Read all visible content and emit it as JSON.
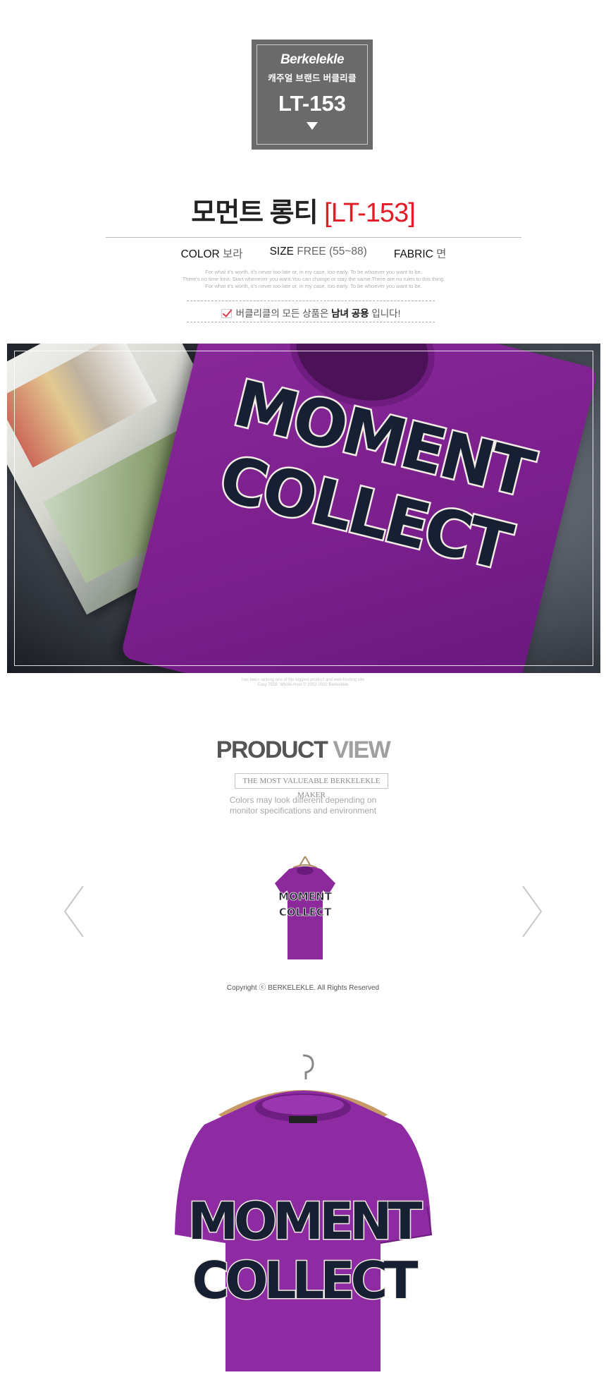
{
  "badge": {
    "brand": "Berkelekle",
    "subtitle": "캐주얼 브랜드 버클리클",
    "code": "LT-153"
  },
  "title": {
    "name": "모먼트 롱티",
    "code": "[LT-153]"
  },
  "specs": [
    {
      "label": "COLOR",
      "value": "보라"
    },
    {
      "label": "SIZE",
      "value": "FREE (55~88)"
    },
    {
      "label": "FABRIC",
      "value": "면"
    }
  ],
  "fine_print": [
    "For what it's worth, it's never too late or, in my case, too early. To be whoever you want to be.",
    "There's no time limit. Start whenever you want.You can change or stay the same.There are no rules to this thing.",
    "For what it's worth, it's never too late or, in my case, too early. To be whoever you want to be."
  ],
  "unisex": {
    "prefix": "버클리클의 모든 상품은",
    "highlight": "남녀 공용",
    "suffix": "입니다!"
  },
  "hero": {
    "shirt_text_line1": "MOMENT",
    "shirt_text_line2": "COLLECT",
    "caption_line1": "has been ranking one of the biggest product and web-hosting site",
    "caption_line2": "Easy 7558. Whole-Host © 2002-2012 Berkelekle"
  },
  "product_view": {
    "title_bold": "PRODUCT",
    "title_light": "VIEW",
    "tagline": "THE MOST VALUEABLE BERKELEKLE MAKER",
    "note_line1": "Colors may look different depending on",
    "note_line2": "monitor specifications and environment",
    "copyright": "Copyright ⓒ BERKELEKLE. All Rights Reserved"
  },
  "icons": {
    "prev": "chevron-left-icon",
    "next": "chevron-right-icon",
    "check": "check-icon"
  },
  "colors": {
    "accent_red": "#e11c26",
    "badge_gray": "#6a6a6a",
    "shirt_purple": "#8c2a9c",
    "shirt_print": "#172033"
  }
}
